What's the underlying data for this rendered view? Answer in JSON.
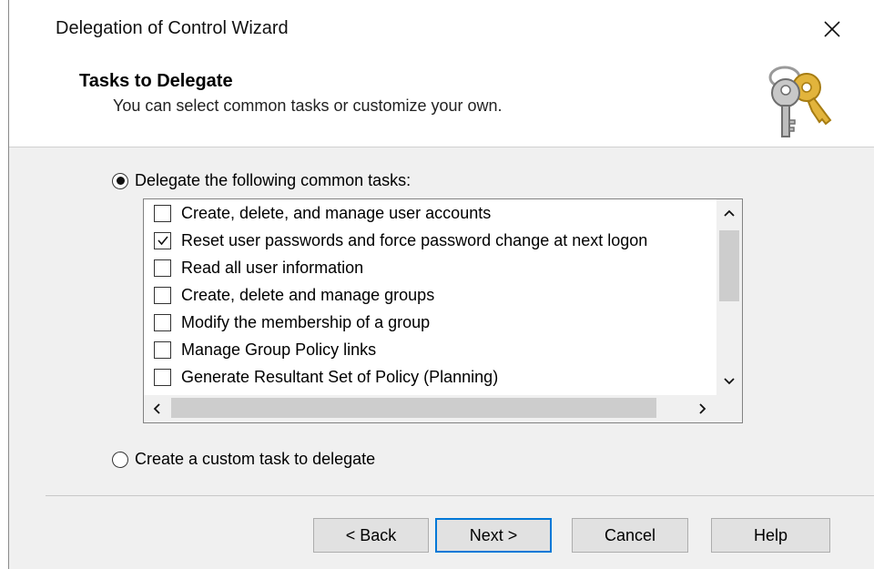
{
  "window": {
    "title": "Delegation of Control Wizard",
    "close_icon": "close-icon"
  },
  "header": {
    "title": "Tasks to Delegate",
    "subtitle": "You can select common tasks or customize your own.",
    "icon": "keys-icon"
  },
  "options": {
    "common": {
      "label": "Delegate the following common tasks:",
      "selected": true
    },
    "custom": {
      "label": "Create a custom task to delegate",
      "selected": false
    }
  },
  "tasks": [
    {
      "label": "Create, delete, and manage user accounts",
      "checked": false
    },
    {
      "label": "Reset user passwords and force password change at next logon",
      "checked": true
    },
    {
      "label": "Read all user information",
      "checked": false
    },
    {
      "label": "Create, delete and manage groups",
      "checked": false
    },
    {
      "label": "Modify the membership of a group",
      "checked": false
    },
    {
      "label": "Manage Group Policy links",
      "checked": false
    },
    {
      "label": "Generate Resultant Set of Policy (Planning)",
      "checked": false
    }
  ],
  "buttons": {
    "back": "< Back",
    "next": "Next >",
    "cancel": "Cancel",
    "help": "Help"
  },
  "colors": {
    "default_button_border": "#0078d7",
    "dialog_background": "#f0f0f0"
  }
}
